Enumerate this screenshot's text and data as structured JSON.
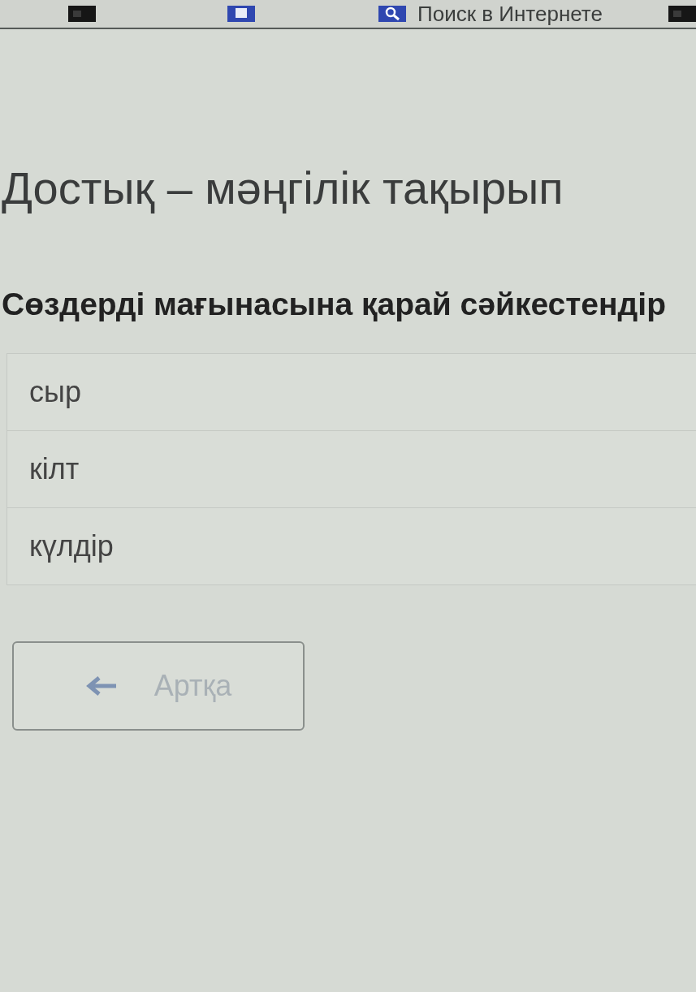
{
  "bookmarks_bar": {
    "items": [
      {
        "kind": "app"
      },
      {
        "kind": "page"
      },
      {
        "kind": "search",
        "label": "Поиск в Интернете"
      },
      {
        "kind": "app"
      }
    ]
  },
  "page": {
    "title": "Достық – мәңгілік тақырып",
    "instruction": "Сөздерді мағынасына қарай сәйкестендір",
    "words": [
      "сыр",
      "кілт",
      "күлдір"
    ],
    "back_button": {
      "label": "Артқа",
      "disabled": true
    }
  }
}
